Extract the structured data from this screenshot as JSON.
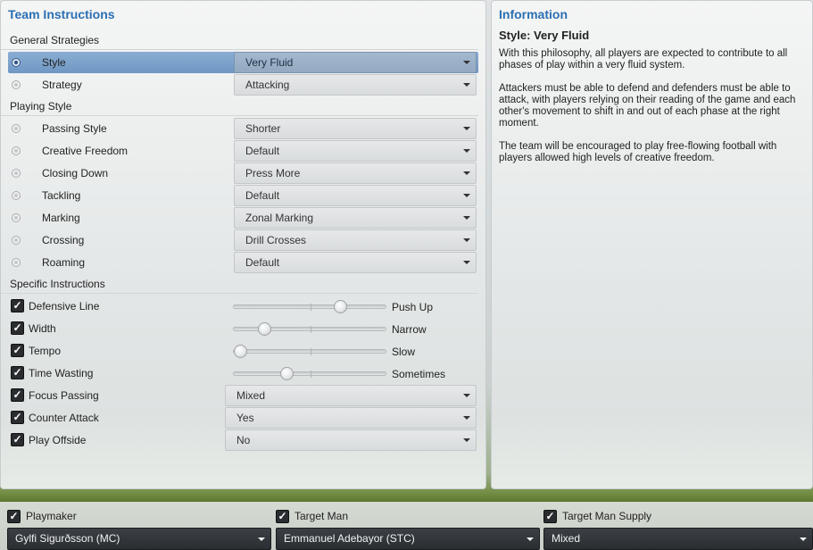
{
  "left_panel": {
    "title": "Team Instructions",
    "general_strategies": {
      "header": "General Strategies",
      "rows": [
        {
          "label": "Style",
          "value": "Very Fluid",
          "selected": true
        },
        {
          "label": "Strategy",
          "value": "Attacking",
          "selected": false
        }
      ]
    },
    "playing_style": {
      "header": "Playing Style",
      "rows": [
        {
          "label": "Passing Style",
          "value": "Shorter"
        },
        {
          "label": "Creative Freedom",
          "value": "Default"
        },
        {
          "label": "Closing Down",
          "value": "Press More"
        },
        {
          "label": "Tackling",
          "value": "Default"
        },
        {
          "label": "Marking",
          "value": "Zonal Marking"
        },
        {
          "label": "Crossing",
          "value": "Drill Crosses"
        },
        {
          "label": "Roaming",
          "value": "Default"
        }
      ]
    },
    "specific_instructions": {
      "header": "Specific Instructions",
      "sliders": [
        {
          "label": "Defensive Line",
          "value_text": "Push Up",
          "level": 0.7,
          "checked": true
        },
        {
          "label": "Width",
          "value_text": "Narrow",
          "level": 0.2,
          "checked": true
        },
        {
          "label": "Tempo",
          "value_text": "Slow",
          "level": 0.04,
          "checked": true
        },
        {
          "label": "Time Wasting",
          "value_text": "Sometimes",
          "level": 0.35,
          "checked": true
        }
      ],
      "dropdowns": [
        {
          "label": "Focus Passing",
          "value": "Mixed",
          "checked": true
        },
        {
          "label": "Counter Attack",
          "value": "Yes",
          "checked": true
        },
        {
          "label": "Play Offside",
          "value": "No",
          "checked": true
        }
      ]
    }
  },
  "right_panel": {
    "title": "Information",
    "heading": "Style: Very Fluid",
    "paragraphs": [
      "With this philosophy, all players are expected to contribute to all phases of play within a very fluid system.",
      "Attackers must be able to defend and defenders must be able to attack, with players relying on their reading of the game and each other's movement to shift in and out of each phase at the right moment.",
      "The team will be encouraged to play free-flowing football with players allowed high levels of creative freedom."
    ]
  },
  "bottom_bar": {
    "columns": [
      {
        "label": "Playmaker",
        "player": "Gylfi Sigurðsson (MC)",
        "checked": true
      },
      {
        "label": "Target Man",
        "player": "Emmanuel Adebayor (STC)",
        "checked": true
      },
      {
        "label": "Target Man Supply",
        "player": "Mixed",
        "checked": true
      }
    ]
  },
  "colors": {
    "title_blue": "#2b6fb2",
    "selected_row": "#7aa0c9",
    "checkbox_dark": "#2a2d30",
    "player_select_dark": "#2e3236"
  }
}
